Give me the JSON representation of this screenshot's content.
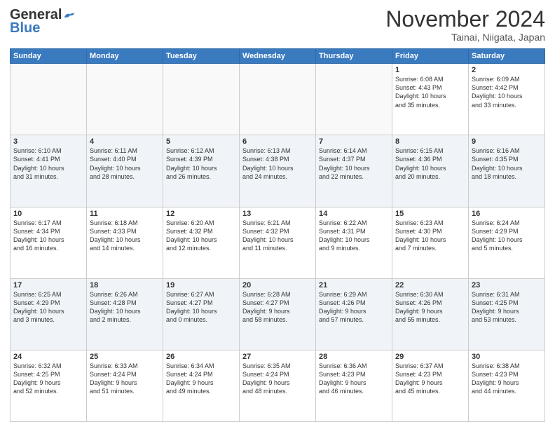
{
  "header": {
    "logo_line1": "General",
    "logo_line2": "Blue",
    "month_title": "November 2024",
    "location": "Tainai, Niigata, Japan"
  },
  "weekdays": [
    "Sunday",
    "Monday",
    "Tuesday",
    "Wednesday",
    "Thursday",
    "Friday",
    "Saturday"
  ],
  "weeks": [
    [
      {
        "day": "",
        "info": ""
      },
      {
        "day": "",
        "info": ""
      },
      {
        "day": "",
        "info": ""
      },
      {
        "day": "",
        "info": ""
      },
      {
        "day": "",
        "info": ""
      },
      {
        "day": "1",
        "info": "Sunrise: 6:08 AM\nSunset: 4:43 PM\nDaylight: 10 hours\nand 35 minutes."
      },
      {
        "day": "2",
        "info": "Sunrise: 6:09 AM\nSunset: 4:42 PM\nDaylight: 10 hours\nand 33 minutes."
      }
    ],
    [
      {
        "day": "3",
        "info": "Sunrise: 6:10 AM\nSunset: 4:41 PM\nDaylight: 10 hours\nand 31 minutes."
      },
      {
        "day": "4",
        "info": "Sunrise: 6:11 AM\nSunset: 4:40 PM\nDaylight: 10 hours\nand 28 minutes."
      },
      {
        "day": "5",
        "info": "Sunrise: 6:12 AM\nSunset: 4:39 PM\nDaylight: 10 hours\nand 26 minutes."
      },
      {
        "day": "6",
        "info": "Sunrise: 6:13 AM\nSunset: 4:38 PM\nDaylight: 10 hours\nand 24 minutes."
      },
      {
        "day": "7",
        "info": "Sunrise: 6:14 AM\nSunset: 4:37 PM\nDaylight: 10 hours\nand 22 minutes."
      },
      {
        "day": "8",
        "info": "Sunrise: 6:15 AM\nSunset: 4:36 PM\nDaylight: 10 hours\nand 20 minutes."
      },
      {
        "day": "9",
        "info": "Sunrise: 6:16 AM\nSunset: 4:35 PM\nDaylight: 10 hours\nand 18 minutes."
      }
    ],
    [
      {
        "day": "10",
        "info": "Sunrise: 6:17 AM\nSunset: 4:34 PM\nDaylight: 10 hours\nand 16 minutes."
      },
      {
        "day": "11",
        "info": "Sunrise: 6:18 AM\nSunset: 4:33 PM\nDaylight: 10 hours\nand 14 minutes."
      },
      {
        "day": "12",
        "info": "Sunrise: 6:20 AM\nSunset: 4:32 PM\nDaylight: 10 hours\nand 12 minutes."
      },
      {
        "day": "13",
        "info": "Sunrise: 6:21 AM\nSunset: 4:32 PM\nDaylight: 10 hours\nand 11 minutes."
      },
      {
        "day": "14",
        "info": "Sunrise: 6:22 AM\nSunset: 4:31 PM\nDaylight: 10 hours\nand 9 minutes."
      },
      {
        "day": "15",
        "info": "Sunrise: 6:23 AM\nSunset: 4:30 PM\nDaylight: 10 hours\nand 7 minutes."
      },
      {
        "day": "16",
        "info": "Sunrise: 6:24 AM\nSunset: 4:29 PM\nDaylight: 10 hours\nand 5 minutes."
      }
    ],
    [
      {
        "day": "17",
        "info": "Sunrise: 6:25 AM\nSunset: 4:29 PM\nDaylight: 10 hours\nand 3 minutes."
      },
      {
        "day": "18",
        "info": "Sunrise: 6:26 AM\nSunset: 4:28 PM\nDaylight: 10 hours\nand 2 minutes."
      },
      {
        "day": "19",
        "info": "Sunrise: 6:27 AM\nSunset: 4:27 PM\nDaylight: 10 hours\nand 0 minutes."
      },
      {
        "day": "20",
        "info": "Sunrise: 6:28 AM\nSunset: 4:27 PM\nDaylight: 9 hours\nand 58 minutes."
      },
      {
        "day": "21",
        "info": "Sunrise: 6:29 AM\nSunset: 4:26 PM\nDaylight: 9 hours\nand 57 minutes."
      },
      {
        "day": "22",
        "info": "Sunrise: 6:30 AM\nSunset: 4:26 PM\nDaylight: 9 hours\nand 55 minutes."
      },
      {
        "day": "23",
        "info": "Sunrise: 6:31 AM\nSunset: 4:25 PM\nDaylight: 9 hours\nand 53 minutes."
      }
    ],
    [
      {
        "day": "24",
        "info": "Sunrise: 6:32 AM\nSunset: 4:25 PM\nDaylight: 9 hours\nand 52 minutes."
      },
      {
        "day": "25",
        "info": "Sunrise: 6:33 AM\nSunset: 4:24 PM\nDaylight: 9 hours\nand 51 minutes."
      },
      {
        "day": "26",
        "info": "Sunrise: 6:34 AM\nSunset: 4:24 PM\nDaylight: 9 hours\nand 49 minutes."
      },
      {
        "day": "27",
        "info": "Sunrise: 6:35 AM\nSunset: 4:24 PM\nDaylight: 9 hours\nand 48 minutes."
      },
      {
        "day": "28",
        "info": "Sunrise: 6:36 AM\nSunset: 4:23 PM\nDaylight: 9 hours\nand 46 minutes."
      },
      {
        "day": "29",
        "info": "Sunrise: 6:37 AM\nSunset: 4:23 PM\nDaylight: 9 hours\nand 45 minutes."
      },
      {
        "day": "30",
        "info": "Sunrise: 6:38 AM\nSunset: 4:23 PM\nDaylight: 9 hours\nand 44 minutes."
      }
    ]
  ]
}
